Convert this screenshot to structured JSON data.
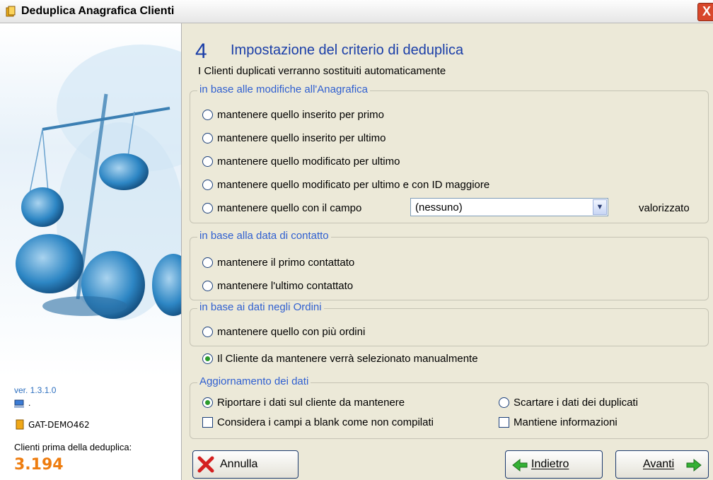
{
  "window": {
    "title": "Deduplica Anagrafica Clienti",
    "close_glyph": "X"
  },
  "sidebar": {
    "version": "ver. 1.3.1.0",
    "computer_label": ".",
    "database": "GAT-DEMO462",
    "count_label": "Clienti prima della deduplica:",
    "count_value": "3.194"
  },
  "step": {
    "number": "4",
    "title": "Impostazione del criterio di deduplica",
    "subtitle": "I Clienti duplicati verranno sostituiti automaticamente"
  },
  "groups": {
    "anagrafica": {
      "legend": "in base alle modifiche all'Anagrafica",
      "options": [
        "mantenere quello inserito per primo",
        "mantenere quello inserito per ultimo",
        "mantenere quello modificato per ultimo",
        "mantenere quello modificato per ultimo e con ID maggiore",
        "mantenere quello con il campo"
      ],
      "field_select_value": "(nessuno)",
      "field_suffix": "valorizzato"
    },
    "contatto": {
      "legend": "in base alla data di contatto",
      "options": [
        "mantenere il primo contattato",
        "mantenere l'ultimo contattato"
      ]
    },
    "ordini": {
      "legend": "in base ai dati negli Ordini",
      "options": [
        "mantenere quello con più ordini"
      ]
    },
    "manual": "Il Cliente da mantenere verrà selezionato manualmente",
    "aggiornamento": {
      "legend": "Aggiornamento dei dati",
      "radio_transfer": "Riportare i dati sul cliente da mantenere",
      "radio_discard": "Scartare i dati dei duplicati",
      "check_blank": "Considera i campi a blank come non compilati",
      "check_keep": "Mantiene informazioni"
    }
  },
  "buttons": {
    "cancel": "Annulla",
    "back": "Indietro",
    "next": "Avanti"
  },
  "colors": {
    "accent": "#1a3ea8",
    "legend": "#2f5fd0",
    "count": "#ee7d10"
  },
  "icons": [
    "app-icon",
    "close-icon",
    "computer-icon",
    "database-icon",
    "cancel-x-icon",
    "back-arrow-icon",
    "next-arrow-icon"
  ]
}
